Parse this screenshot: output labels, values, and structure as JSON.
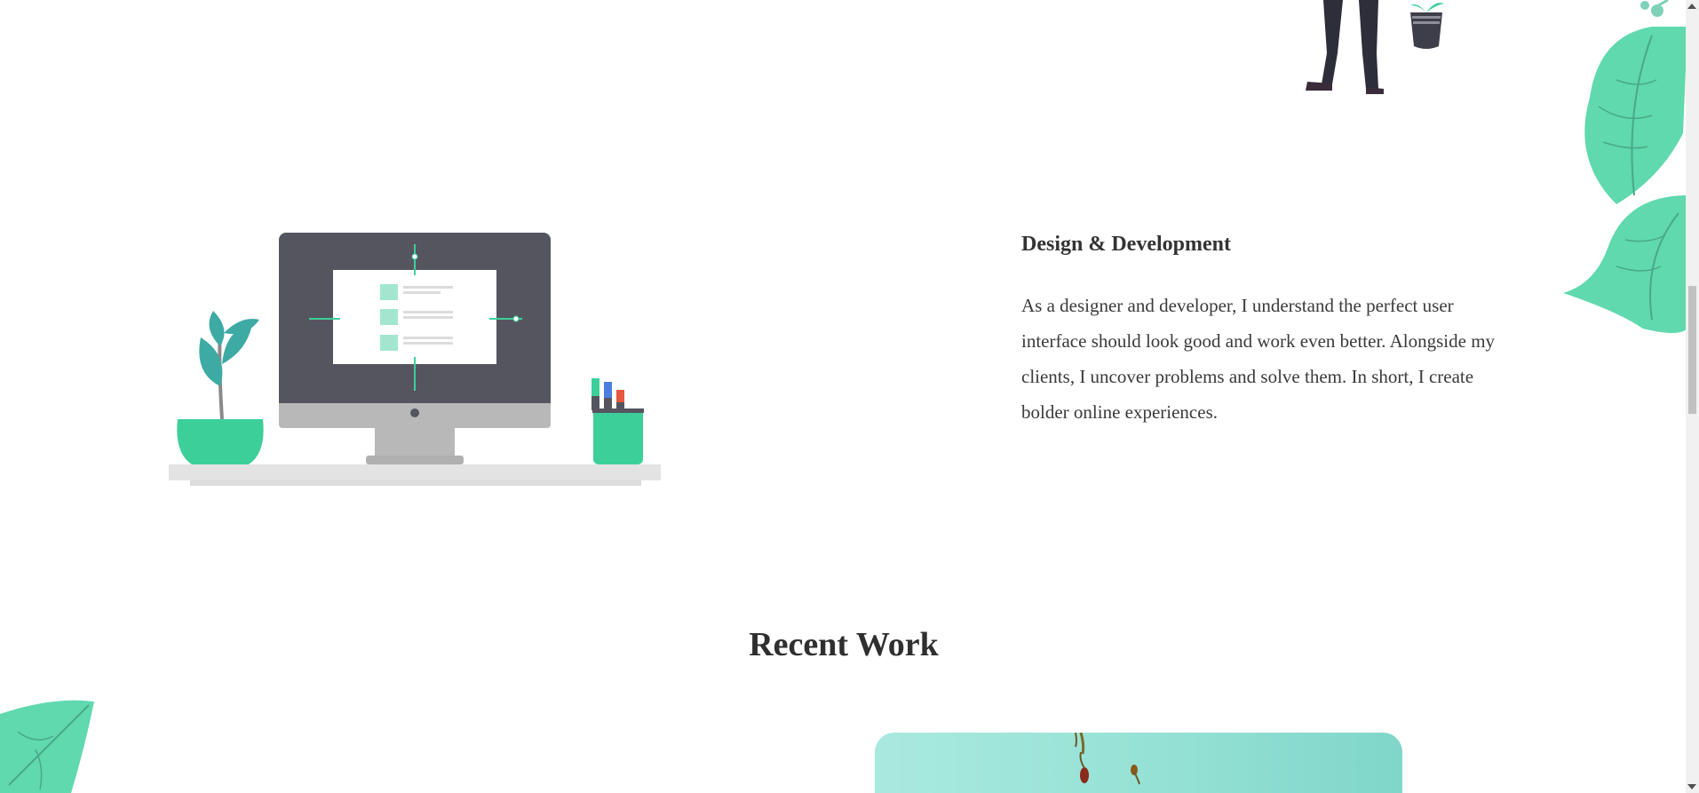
{
  "about": {
    "heading": "Design & Development",
    "body": "As a designer and developer, I understand the perfect user interface should look good and work even better. Alongside my clients, I uncover problems and solve them. In short, I create bolder online experiences."
  },
  "recent_work": {
    "title": "Recent Work"
  },
  "colors": {
    "accent_green": "#3dcf9a",
    "leaf_green": "#5fd9ad",
    "monitor_dark": "#555560",
    "text": "#333333"
  },
  "icons": {
    "illustration": "desk-with-monitor-illustration",
    "person": "person-with-plant-illustration",
    "leaves": "decorative-leaf-icon"
  }
}
